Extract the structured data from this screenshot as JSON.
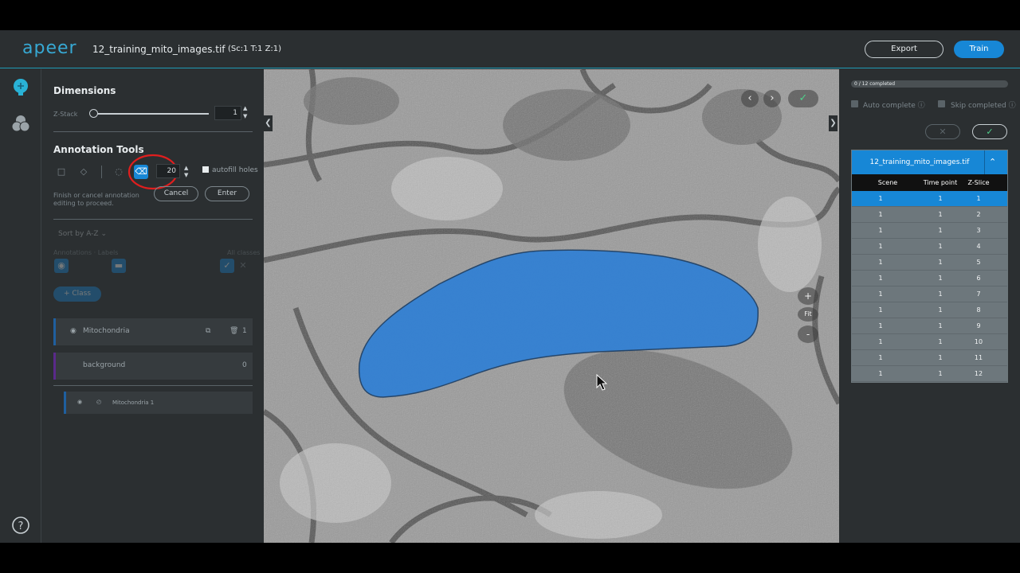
{
  "header": {
    "logo": "apeer",
    "file_title": "12_training_mito_images.tif",
    "file_meta": "(Sc:1 T:1 Z:1)",
    "export_label": "Export",
    "train_label": "Train"
  },
  "colors": {
    "accent": "#1787d6",
    "mask": "#2f7fd4",
    "highlight_ring": "#e01e1e"
  },
  "left_panel": {
    "dimensions_title": "Dimensions",
    "zstack_label": "Z-Stack",
    "zstack_value": "1",
    "annotation_title": "Annotation Tools",
    "brush_size": "20",
    "autofill_label": "autofill holes",
    "warning_text": "Finish or cancel annotation editing to proceed.",
    "cancel_label": "Cancel",
    "enter_label": "Enter",
    "sort_label": "Sort by A-Z",
    "annotations_label": "Annotations",
    "labels_label": "Labels",
    "all_classes_label": "All classes",
    "class_button": "+ Class",
    "classes": [
      {
        "name": "Mitochondria",
        "count": "1",
        "color": "#1f5f9f"
      },
      {
        "name": "background",
        "count": "0",
        "color": "#5a2a8a"
      }
    ],
    "annotation_item": "Mitochondria 1"
  },
  "right_panel": {
    "progress_text": "0 / 12 completed",
    "progress_fraction": 0,
    "auto_complete_label": "Auto complete",
    "skip_completed_label": "Skip completed",
    "table_title": "12_training_mito_images.tif",
    "columns": [
      "Scene",
      "Time point",
      "Z-Slice"
    ],
    "rows": [
      [
        "1",
        "1",
        "1"
      ],
      [
        "1",
        "1",
        "2"
      ],
      [
        "1",
        "1",
        "3"
      ],
      [
        "1",
        "1",
        "4"
      ],
      [
        "1",
        "1",
        "5"
      ],
      [
        "1",
        "1",
        "6"
      ],
      [
        "1",
        "1",
        "7"
      ],
      [
        "1",
        "1",
        "8"
      ],
      [
        "1",
        "1",
        "9"
      ],
      [
        "1",
        "1",
        "10"
      ],
      [
        "1",
        "1",
        "11"
      ],
      [
        "1",
        "1",
        "12"
      ]
    ],
    "selected_row": 0
  },
  "viewer": {
    "zoom_in": "+",
    "fit_label": "Fit",
    "zoom_out": "-"
  },
  "icons": [
    "brain-icon",
    "layers-icon",
    "help-icon",
    "rectangle-icon",
    "polygon-icon",
    "brush-icon",
    "eraser-icon",
    "eye-icon",
    "check-icon",
    "close-icon",
    "chevron-left-icon",
    "chevron-right-icon",
    "chevron-up-icon",
    "chevron-down-icon",
    "trash-icon",
    "copy-icon"
  ]
}
